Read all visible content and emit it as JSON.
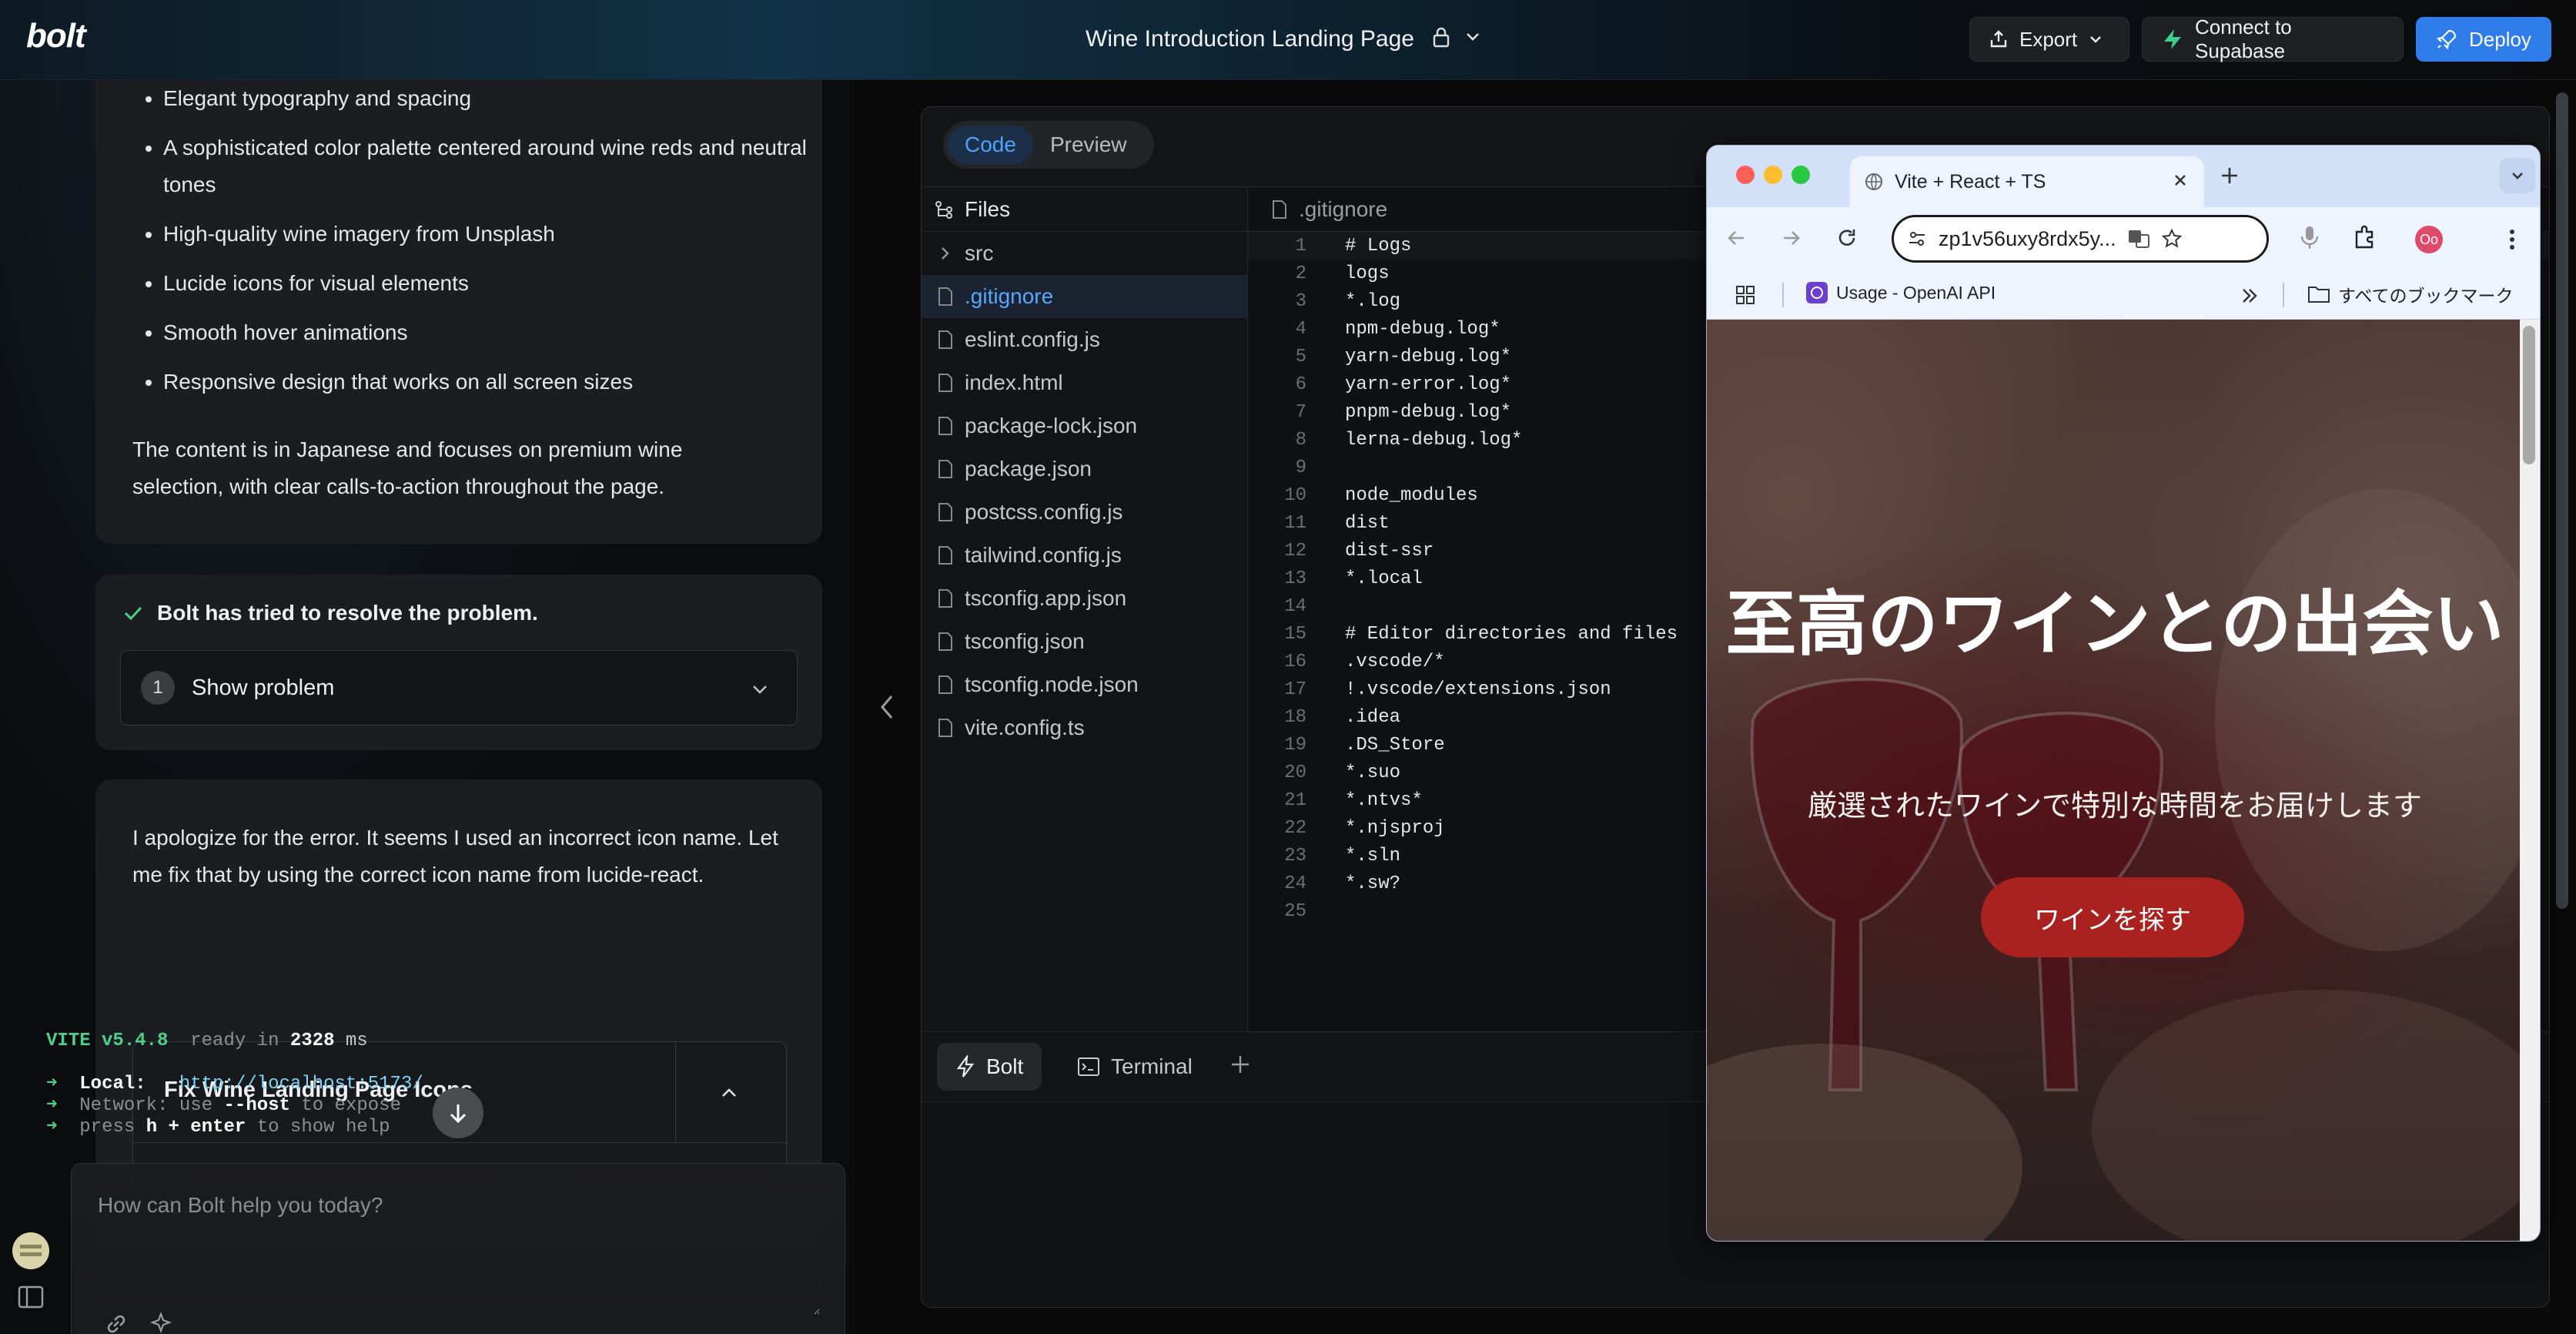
{
  "app": {
    "logo": "bolt",
    "project_title": "Wine Introduction Landing Page"
  },
  "header": {
    "export_label": "Export",
    "supabase_label": "Connect to Supabase",
    "deploy_label": "Deploy",
    "accent": "#2f7dea"
  },
  "chat": {
    "bullets": [
      "Elegant typography and spacing",
      "A sophisticated color palette centered around wine reds and neutral tones",
      "High-quality wine imagery from Unsplash",
      "Lucide icons for visual elements",
      "Smooth hover animations",
      "Responsive design that works on all screen sizes"
    ],
    "summary": "The content is in Japanese and focuses on premium wine selection, with clear calls-to-action throughout the page.",
    "resolved_text": "Bolt has tried to resolve the problem.",
    "problem_count": "1",
    "show_problem_label": "Show problem",
    "apology": "I apologize for the error. It seems I used an incorrect icon name. Let me fix that by using the correct icon name from lucide-react.",
    "artifact_title": "Fix Wine Landing Page Icons",
    "prompt_placeholder": "How can Bolt help you today?"
  },
  "workbench": {
    "tabs": {
      "code": "Code",
      "preview": "Preview"
    },
    "files_label": "Files",
    "files": [
      {
        "name": "src",
        "type": "folder"
      },
      {
        "name": ".gitignore",
        "type": "file",
        "active": true
      },
      {
        "name": "eslint.config.js",
        "type": "file"
      },
      {
        "name": "index.html",
        "type": "file"
      },
      {
        "name": "package-lock.json",
        "type": "file"
      },
      {
        "name": "package.json",
        "type": "file"
      },
      {
        "name": "postcss.config.js",
        "type": "file"
      },
      {
        "name": "tailwind.config.js",
        "type": "file"
      },
      {
        "name": "tsconfig.app.json",
        "type": "file"
      },
      {
        "name": "tsconfig.json",
        "type": "file"
      },
      {
        "name": "tsconfig.node.json",
        "type": "file"
      },
      {
        "name": "vite.config.ts",
        "type": "file"
      }
    ],
    "editor_tab": ".gitignore",
    "code_lines": [
      "# Logs",
      "logs",
      "*.log",
      "npm-debug.log*",
      "yarn-debug.log*",
      "yarn-error.log*",
      "pnpm-debug.log*",
      "lerna-debug.log*",
      "",
      "node_modules",
      "dist",
      "dist-ssr",
      "*.local",
      "",
      "# Editor directories and files",
      ".vscode/*",
      "!.vscode/extensions.json",
      ".idea",
      ".DS_Store",
      "*.suo",
      "*.ntvs*",
      "*.njsproj",
      "*.sln",
      "*.sw?",
      ""
    ],
    "terminal_tabs": {
      "bolt": "Bolt",
      "terminal": "Terminal"
    },
    "terminal": {
      "vite": "VITE",
      "version": "v5.4.8",
      "ready": "ready in",
      "ms_value": "2328",
      "ms": "ms",
      "arrow": "➜",
      "local_label": "Local:",
      "local_url": "http://localhost:5173/",
      "network_label": "Network:",
      "network_text1": "use",
      "network_flag": "--host",
      "network_text2": "to expose",
      "help_text1": "press",
      "help_key": "h + enter",
      "help_text2": "to show help"
    }
  },
  "browser": {
    "tab_title": "Vite + React + TS",
    "url": "zp1v56uxy8rdx5y...",
    "bookmark_openai": "Usage - OpenAI API",
    "bookmarks_folder": "すべてのブックマーク",
    "profile_initials": "Oo",
    "hero_title": "至高のワインとの出会い",
    "hero_subtitle": "厳選されたワインで特別な時間をお届けします",
    "hero_cta": "ワインを探す",
    "cta_color": "#a9221f"
  }
}
